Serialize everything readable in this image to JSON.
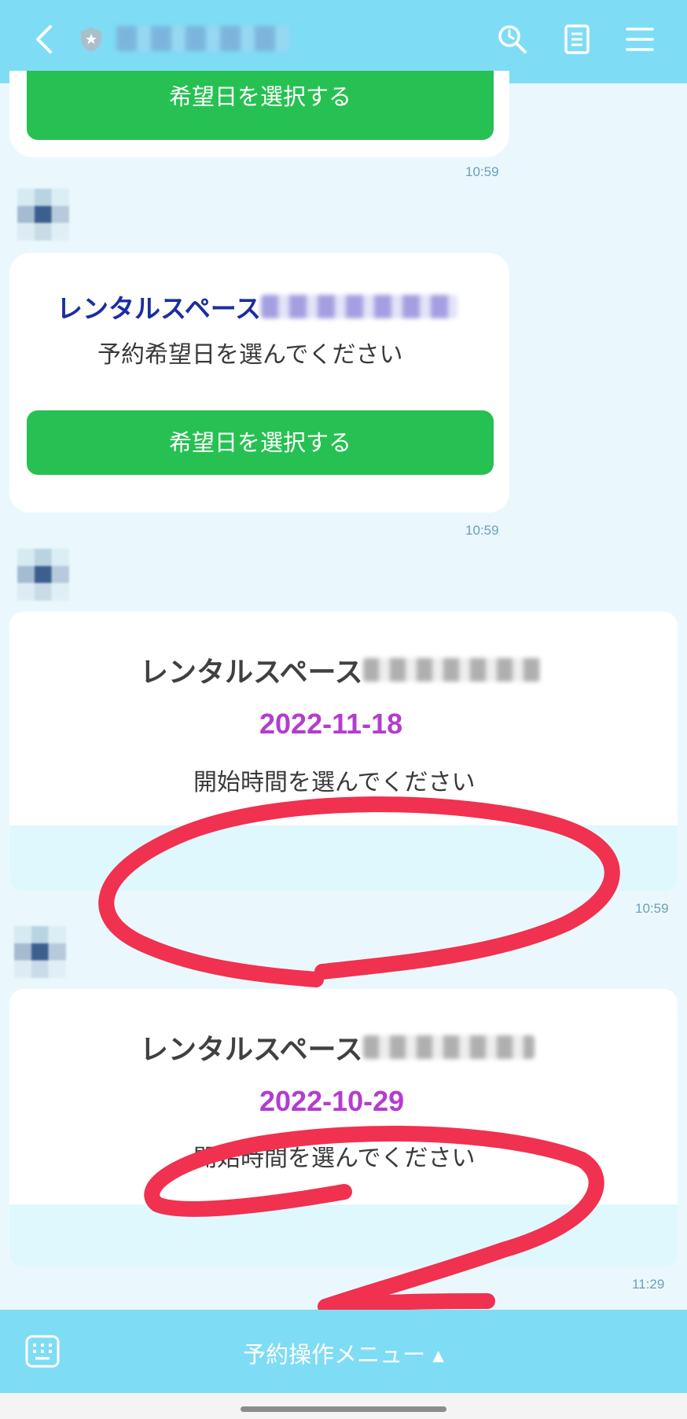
{
  "header": {
    "back_icon": "chevron-left-icon",
    "badge_icon": "shield-star-icon",
    "search_icon": "search-icon",
    "notes_icon": "notes-icon",
    "menu_icon": "hamburger-icon"
  },
  "messages": [
    {
      "button_label": "希望日を選択する",
      "time": "10:59"
    },
    {
      "title": "レンタルスペース",
      "subtitle": "予約希望日を選んでください",
      "button_label": "希望日を選択する",
      "time": "10:59"
    },
    {
      "title": "レンタルスペース",
      "date": "2022-11-18",
      "subtitle": "開始時間を選んでください",
      "time": "10:59"
    },
    {
      "title": "レンタルスペース",
      "date": "2022-10-29",
      "subtitle": "開始時間を選んでください",
      "time": "11:29"
    }
  ],
  "bottom_bar": {
    "keyboard_icon": "keyboard-icon",
    "menu_label": "予約操作メニュー ▴"
  },
  "colors": {
    "header_bg": "#7fdcf5",
    "button_green": "#26c152",
    "date_purple": "#b53ccf",
    "title_blue": "#1a2ea0",
    "annotation_red": "#f0314f"
  }
}
